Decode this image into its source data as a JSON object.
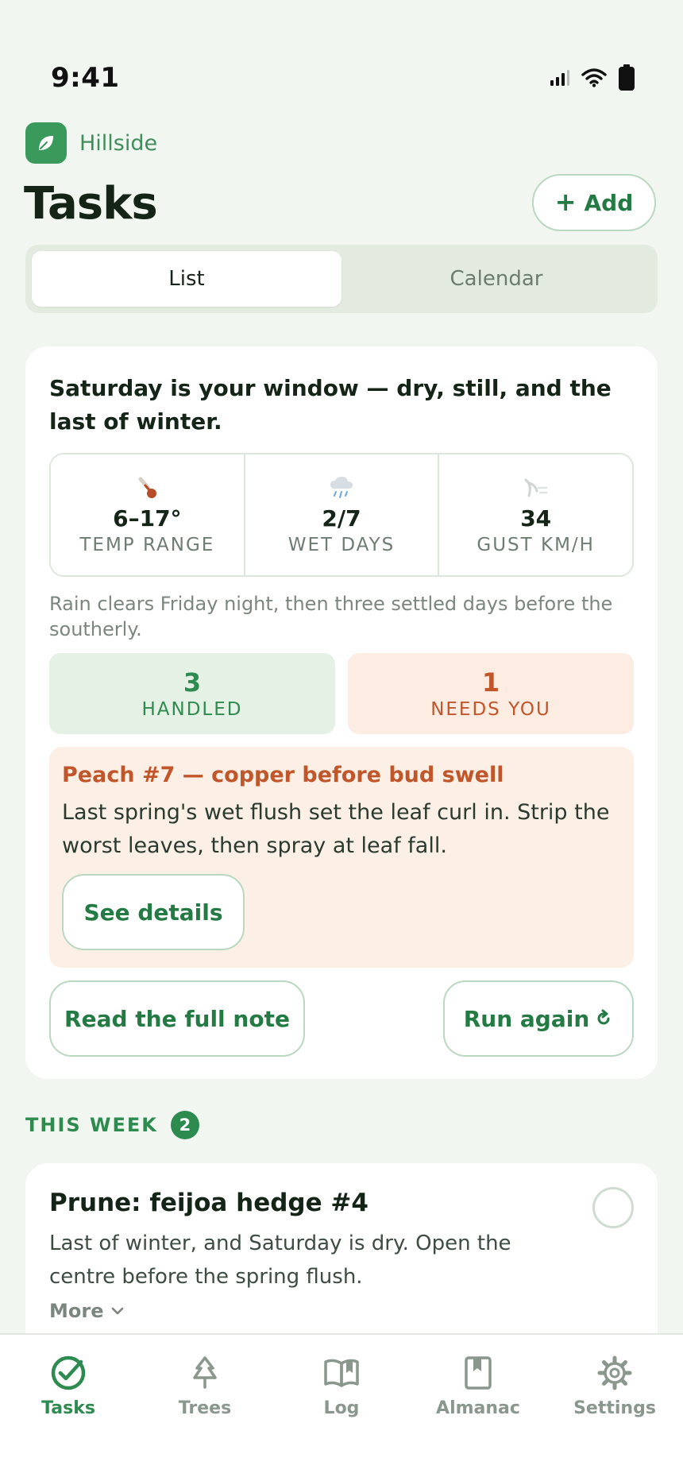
{
  "status_bar": {
    "time": "9:41"
  },
  "brand": {
    "name": "Hillside",
    "logo_icon": "leaf-icon",
    "color": "#3a9a5b"
  },
  "header": {
    "title": "Tasks",
    "add_label": "Add"
  },
  "view_toggle": {
    "options": [
      "List",
      "Calendar"
    ],
    "selected": "List"
  },
  "summary": {
    "headline": "Saturday is your window — dry, still, and the last of winter.",
    "metrics": [
      {
        "icon": "thermometer-icon",
        "value": "6–17°",
        "label": "TEMP RANGE"
      },
      {
        "icon": "rain-cloud-icon",
        "value": "2/7",
        "label": "WET DAYS"
      },
      {
        "icon": "wind-icon",
        "value": "34",
        "label": "GUST KM/H"
      }
    ],
    "forecast": "Rain clears Friday night, then three settled days before the southerly.",
    "handled": {
      "count": "3",
      "label": "HANDLED"
    },
    "needs_you": {
      "count": "1",
      "label": "NEEDS YOU"
    },
    "alert": {
      "title": "Peach #7 — copper before bud swell",
      "body": "Last spring's wet flush set the leaf curl in. Strip the worst leaves, then spray at leaf fall.",
      "button_label": "See details"
    },
    "read_note_label": "Read the full note",
    "run_again_label": "Run again"
  },
  "this_week": {
    "title": "THIS WEEK",
    "count": "2",
    "tasks": [
      {
        "title": "Prune: feijoa hedge #4",
        "description": "Last of winter, and Saturday is dry. Open the centre before the spring flush.",
        "more_label": "More"
      }
    ]
  },
  "tab_bar": {
    "items": [
      {
        "label": "Tasks",
        "icon": "check-circle-icon",
        "active": true
      },
      {
        "label": "Trees",
        "icon": "tree-icon",
        "active": false
      },
      {
        "label": "Log",
        "icon": "book-open-icon",
        "active": false
      },
      {
        "label": "Almanac",
        "icon": "bookmark-book-icon",
        "active": false
      },
      {
        "label": "Settings",
        "icon": "gear-icon",
        "active": false
      }
    ]
  },
  "colors": {
    "accent": "#2e8b4f",
    "warning": "#c1562a",
    "background": "#f1f6f0"
  }
}
